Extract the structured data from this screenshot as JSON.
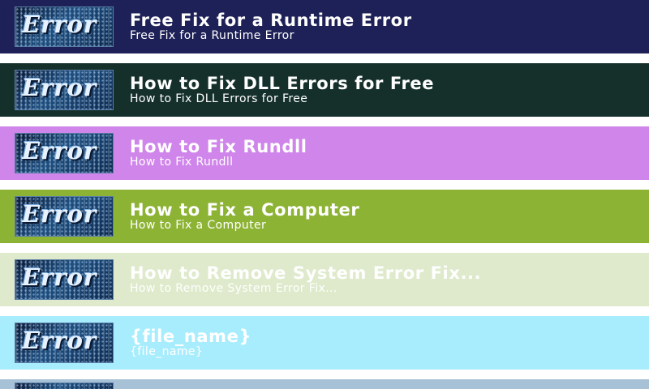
{
  "items": [
    {
      "title": "Free Fix for a Runtime Error",
      "subtitle": "Free Fix for a Runtime Error",
      "bg": "#1e2157",
      "thumb_text": "Error",
      "thumb_icon": "error-thumbnail-icon"
    },
    {
      "title": "How to Fix DLL Errors for Free",
      "subtitle": "How to Fix DLL Errors for Free",
      "bg": "#15302b",
      "thumb_text": "Error",
      "thumb_icon": "error-thumbnail-icon"
    },
    {
      "title": "How to Fix Rundll",
      "subtitle": "How to Fix Rundll",
      "bg": "#cf85ea",
      "thumb_text": "Error",
      "thumb_icon": "error-thumbnail-icon"
    },
    {
      "title": "How to Fix a Computer",
      "subtitle": "How to Fix a Computer",
      "bg": "#8db335",
      "thumb_text": "Error",
      "thumb_icon": "error-thumbnail-icon"
    },
    {
      "title": "How to Remove System Error Fix...",
      "subtitle": "How to Remove System Error Fix...",
      "bg": "#deeacb",
      "thumb_text": "Error",
      "thumb_icon": "error-thumbnail-icon"
    },
    {
      "title": "{file_name}",
      "subtitle": "{file_name}",
      "bg": "#a8edfd",
      "thumb_text": "Error",
      "thumb_icon": "error-thumbnail-icon"
    },
    {
      "title": "",
      "subtitle": "",
      "bg": "#a7c1d6",
      "thumb_text": "",
      "thumb_icon": "error-thumbnail-icon"
    }
  ]
}
